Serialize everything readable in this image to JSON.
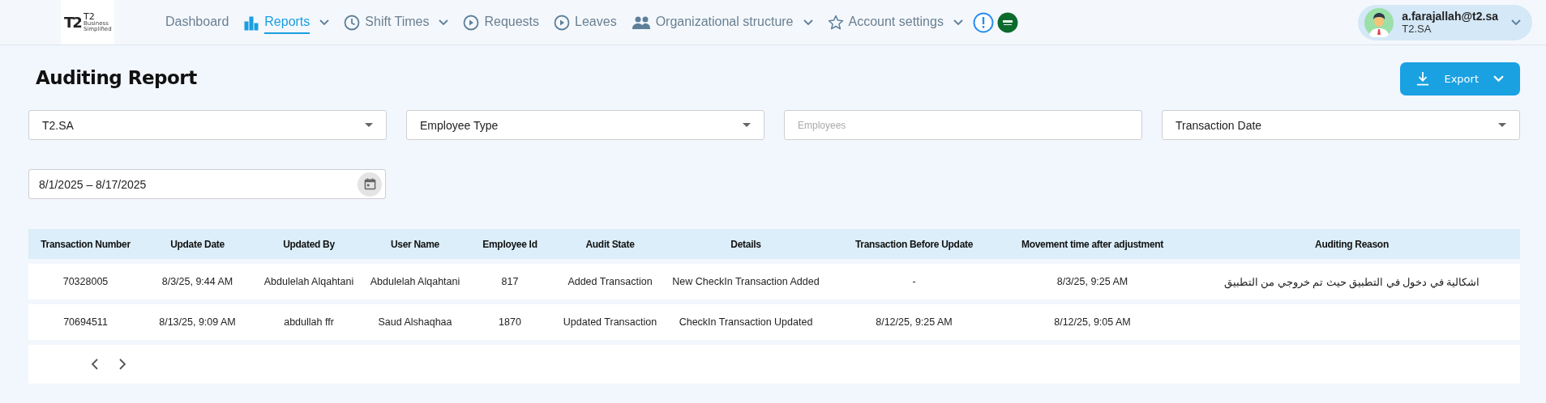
{
  "logo": {
    "mark": "T2",
    "name": "T2",
    "tagline": "Business Simplified"
  },
  "nav": [
    {
      "label": "Dashboard",
      "kind": "plain",
      "selected": false,
      "dropdown": false
    },
    {
      "label": "Reports",
      "kind": "chart",
      "selected": true,
      "dropdown": true
    },
    {
      "label": "Shift Times",
      "kind": "time",
      "selected": false,
      "dropdown": true
    },
    {
      "label": "Requests",
      "kind": "action",
      "selected": false,
      "dropdown": false
    },
    {
      "label": "Leaves",
      "kind": "action",
      "selected": false,
      "dropdown": false
    },
    {
      "label": "Organizational structure",
      "kind": "team",
      "selected": false,
      "dropdown": true
    },
    {
      "label": "Account settings",
      "kind": "account",
      "selected": false,
      "dropdown": true
    }
  ],
  "user": {
    "email": "a.farajallah@t2.sa",
    "company": "T2.SA"
  },
  "page_title": "Auditing Report",
  "export_button": "Export",
  "filters": [
    {
      "kind": "select",
      "value": "T2.SA"
    },
    {
      "kind": "select",
      "value": "Employee Type"
    },
    {
      "kind": "input",
      "placeholder": "Employees"
    },
    {
      "kind": "select",
      "value": "Transaction Date"
    }
  ],
  "date_range": "8/1/2025 – 8/17/2025",
  "table": {
    "columns": [
      "Transaction Number",
      "Update Date",
      "Updated By",
      "User Name",
      "Employee Id",
      "Audit State",
      "Details",
      "Transaction Before Update",
      "Movement time after adjustment",
      "Auditing Reason"
    ],
    "rows": [
      [
        "70328005",
        "8/3/25, 9:44 AM",
        "Abdulelah Alqahtani",
        "Abdulelah Alqahtani",
        "817",
        "Added Transaction",
        "New CheckIn Transaction Added",
        "-",
        "8/3/25, 9:25 AM",
        "اشكالية في دخول في التطبيق حيث تم خروجي من التطبيق"
      ],
      [
        "70694511",
        "8/13/25, 9:09 AM",
        "abdullah ffr",
        "Saud Alshaqhaa",
        "1870",
        "Updated Transaction",
        "CheckIn Transaction Updated",
        "8/12/25, 9:25 AM",
        "8/12/25, 9:05 AM",
        ""
      ]
    ]
  }
}
